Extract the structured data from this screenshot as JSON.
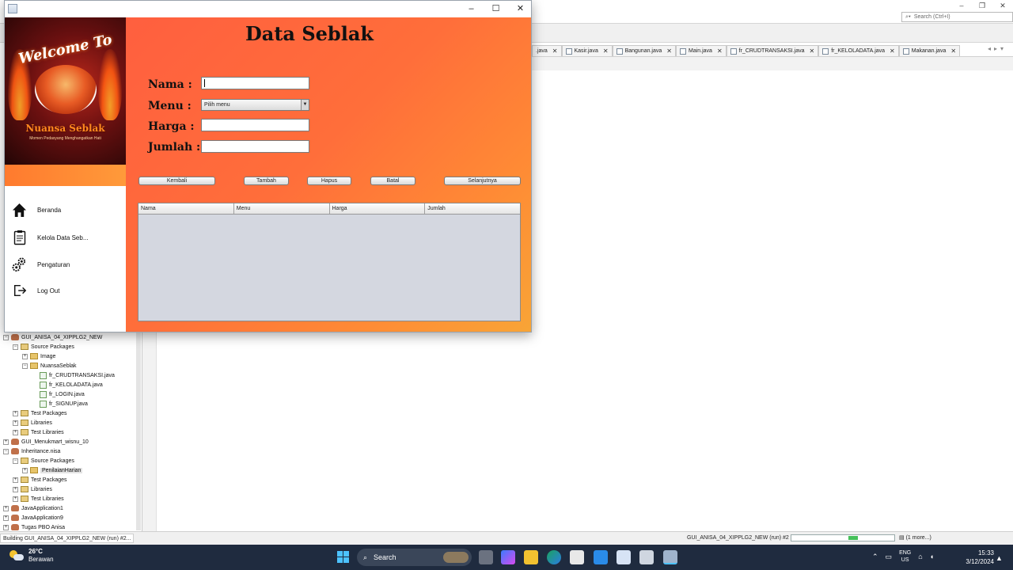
{
  "ide": {
    "search_placeholder": "Search (Ctrl+I)",
    "tabs": [
      {
        "label": ".java"
      },
      {
        "label": "Kasir.java"
      },
      {
        "label": "Bangunan.java"
      },
      {
        "label": "Main.java"
      },
      {
        "label": "fr_CRUDTRANSAKSI.java"
      },
      {
        "label": "fr_KELOLADATA.java"
      },
      {
        "label": "Makanan.java"
      }
    ],
    "tree": [
      {
        "label": "GUI_ANISA_04_XIPPLG2_NEW",
        "icon": "project-icon",
        "depth": 0,
        "exp": "−"
      },
      {
        "label": "Source Packages",
        "icon": "package-folder-icon",
        "depth": 1,
        "exp": "−"
      },
      {
        "label": "Image",
        "icon": "package-icon",
        "depth": 2,
        "exp": "+"
      },
      {
        "label": "NuansaSeblak",
        "icon": "package-icon",
        "depth": 2,
        "exp": "−"
      },
      {
        "label": "fr_CRUDTRANSAKSI.java",
        "icon": "java-file-icon",
        "depth": 3,
        "exp": ""
      },
      {
        "label": "fr_KELOLADATA.java",
        "icon": "java-file-icon",
        "depth": 3,
        "exp": ""
      },
      {
        "label": "fr_LOGIN.java",
        "icon": "java-file-icon",
        "depth": 3,
        "exp": ""
      },
      {
        "label": "fr_SIGNUP.java",
        "icon": "java-file-icon",
        "depth": 3,
        "exp": ""
      },
      {
        "label": "Test Packages",
        "icon": "package-folder-icon",
        "depth": 1,
        "exp": "+"
      },
      {
        "label": "Libraries",
        "icon": "library-icon",
        "depth": 1,
        "exp": "+"
      },
      {
        "label": "Test Libraries",
        "icon": "library-icon",
        "depth": 1,
        "exp": "+"
      },
      {
        "label": "GUI_Menukmart_wisnu_10",
        "icon": "project-icon",
        "depth": 0,
        "exp": "+"
      },
      {
        "label": "Inheritance.nisa",
        "icon": "project-icon",
        "depth": 0,
        "exp": "−"
      },
      {
        "label": "Source Packages",
        "icon": "package-folder-icon",
        "depth": 1,
        "exp": "−"
      },
      {
        "label": "PenilaianHarian",
        "icon": "package-icon",
        "depth": 2,
        "exp": "+",
        "selected": true
      },
      {
        "label": "Test Packages",
        "icon": "package-folder-icon",
        "depth": 1,
        "exp": "+"
      },
      {
        "label": "Libraries",
        "icon": "library-icon",
        "depth": 1,
        "exp": "+"
      },
      {
        "label": "Test Libraries",
        "icon": "library-icon",
        "depth": 1,
        "exp": "+"
      },
      {
        "label": "JavaApplication1",
        "icon": "project-icon",
        "depth": 0,
        "exp": "+"
      },
      {
        "label": "JavaApplication9",
        "icon": "project-icon",
        "depth": 0,
        "exp": "+"
      },
      {
        "label": "Tugas PBO Anisa",
        "icon": "project-icon",
        "depth": 0,
        "exp": "+"
      }
    ],
    "status_left": "Building GUI_ANISA_04_XIPPLG2_NEW (run) #2...",
    "status_right": "GUI_ANISA_04_XIPPLG2_NEW (run) #2",
    "status_more": "(1 more...)"
  },
  "app": {
    "banner": {
      "welcome": "Welcome To",
      "brand": "Nuansa Seblak",
      "tagline": "Momen Pedasyang Menghangatkan Hati"
    },
    "sidebar": [
      {
        "label": "Beranda",
        "icon": "home-icon"
      },
      {
        "label": "Kelola Data Seb...",
        "icon": "clipboard-icon"
      },
      {
        "label": "Pengaturan",
        "icon": "gears-icon"
      },
      {
        "label": "Log Out",
        "icon": "logout-icon"
      }
    ],
    "title": "Data Seblak",
    "form": {
      "nama_label": "Nama :",
      "menu_label": "Menu :",
      "harga_label": "Harga :",
      "jumlah_label": "Jumlah :",
      "nama_value": "",
      "menu_selected": "Pilih menu",
      "harga_value": "",
      "jumlah_value": ""
    },
    "buttons": {
      "kembali": "Kembali",
      "tambah": "Tambah",
      "hapus": "Hapus",
      "batal": "Batal",
      "selanjutnya": "Selanjutnya"
    },
    "table": {
      "columns": [
        "Nama",
        "Menu",
        "Harga",
        "Jumlah"
      ]
    }
  },
  "taskbar": {
    "weather_temp": "26°C",
    "weather_desc": "Berawan",
    "search_label": "Search",
    "lang_top": "ENG",
    "lang_bottom": "US",
    "time": "15:33",
    "date": "3/12/2024"
  },
  "colors": {
    "content_gradient_start": "#ff5f3f",
    "content_gradient_end": "#f8a536",
    "taskbar": "#1f2b3f",
    "accent_blue": "#4cc2ff"
  }
}
